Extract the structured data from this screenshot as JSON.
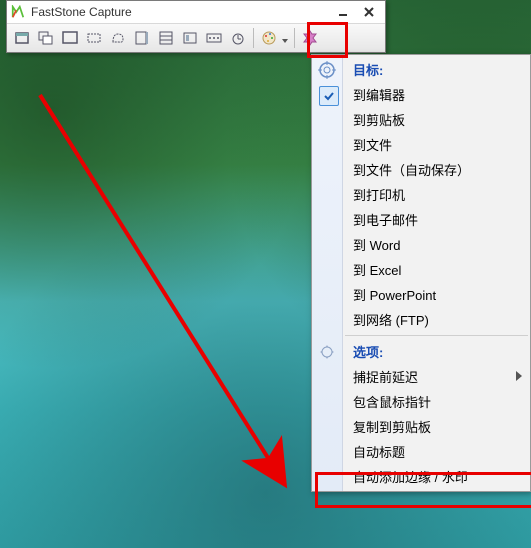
{
  "app": {
    "title": "FastStone Capture"
  },
  "toolbar_icons": [
    "active-window",
    "window",
    "fullscreen",
    "rect",
    "freehand",
    "scroll",
    "fixed",
    "repeat",
    "screen",
    "delay",
    "draw",
    "record"
  ],
  "menu": {
    "section1_title": "目标:",
    "items1": [
      {
        "label": "到编辑器",
        "checked": true
      },
      {
        "label": "到剪贴板"
      },
      {
        "label": "到文件"
      },
      {
        "label": "到文件（自动保存）"
      },
      {
        "label": "到打印机"
      },
      {
        "label": "到电子邮件"
      },
      {
        "label": "到 Word"
      },
      {
        "label": "到 Excel"
      },
      {
        "label": "到 PowerPoint"
      },
      {
        "label": "到网络 (FTP)"
      }
    ],
    "section2_title": "选项:",
    "items2": [
      {
        "label": "捕捉前延迟",
        "submenu": true
      },
      {
        "label": "包含鼠标指针"
      },
      {
        "label": "复制到剪贴板"
      },
      {
        "label": "自动标题"
      },
      {
        "label": "自动添加边缘 / 水印"
      }
    ]
  }
}
